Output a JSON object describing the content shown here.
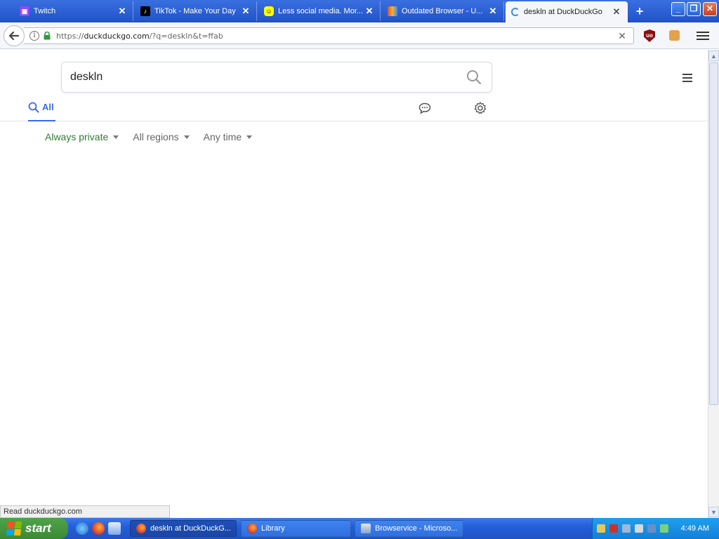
{
  "browser": {
    "tabs": [
      {
        "title": "Twitch",
        "icon": "twitch-icon",
        "color": "#9146ff"
      },
      {
        "title": "TikTok - Make Your Day",
        "icon": "tiktok-icon",
        "color": "#000000"
      },
      {
        "title": "Less social media. Mor...",
        "icon": "snapchat-icon",
        "color": "#fffc00"
      },
      {
        "title": "Outdated Browser - U...",
        "icon": "outdated-browser-icon",
        "color": "#d4a017"
      },
      {
        "title": "deskln at DuckDuckGo",
        "icon": "loading-spinner-icon",
        "color": "#3b8fe0"
      }
    ],
    "close_glyph": "✕",
    "new_tab_glyph": "+",
    "url": {
      "prefix": "https://",
      "domain": "duckduckgo.com",
      "path": "/?q=deskln&t=ffab"
    },
    "ublock_label": "uo"
  },
  "page": {
    "query": "deskln",
    "tab_all_label": "All",
    "filters": {
      "safe": "Always private",
      "region": "All regions",
      "time": "Any time"
    }
  },
  "status_text": "Read duckduckgo.com",
  "taskbar": {
    "start_label": "start",
    "tasks": [
      {
        "label": "deskln at DuckDuckG...",
        "icon": "firefox-icon"
      },
      {
        "label": "Library",
        "icon": "firefox-icon"
      },
      {
        "label": "Browservice - Microso...",
        "icon": "app-window-icon"
      }
    ],
    "clock": "4:49 AM"
  },
  "colors": {
    "accent_blue": "#3969ef",
    "private_green": "#2f7d32",
    "xp_taskbar": "#245edb",
    "xp_start": "#3c8a34"
  }
}
